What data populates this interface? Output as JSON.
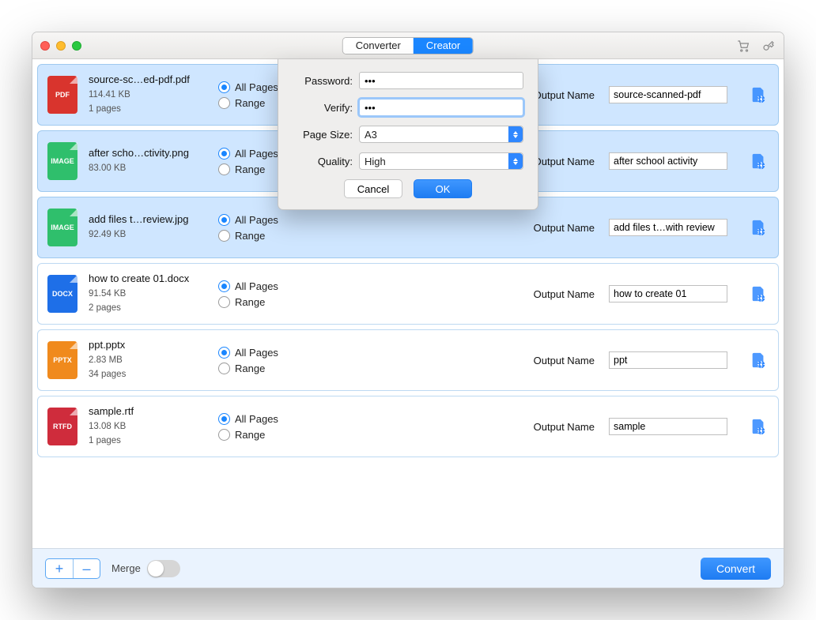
{
  "tabs": {
    "converter": "Converter",
    "creator": "Creator"
  },
  "labels": {
    "all_pages": "All Pages",
    "range": "Range",
    "output_name": "Output Name",
    "merge": "Merge",
    "convert": "Convert",
    "add": "+",
    "remove": "–"
  },
  "dialog": {
    "password_label": "Password:",
    "password_value": "•••",
    "verify_label": "Verify:",
    "verify_value": "•••",
    "pagesize_label": "Page Size:",
    "pagesize_value": "A3",
    "quality_label": "Quality:",
    "quality_value": "High",
    "cancel": "Cancel",
    "ok": "OK"
  },
  "files": [
    {
      "type": "PDF",
      "cls": "fi-pdf",
      "name": "source-sc…ed-pdf.pdf",
      "size": "114.41 KB",
      "pages": "1 pages",
      "output": "source-scanned-pdf",
      "selected": true
    },
    {
      "type": "IMAGE",
      "cls": "fi-image",
      "name": "after scho…ctivity.png",
      "size": "83.00 KB",
      "pages": "",
      "output": "after school activity",
      "selected": true
    },
    {
      "type": "IMAGE",
      "cls": "fi-image",
      "name": "add files t…review.jpg",
      "size": "92.49 KB",
      "pages": "",
      "output": "add files t…with review",
      "selected": true
    },
    {
      "type": "DOCX",
      "cls": "fi-docx",
      "name": "how to create 01.docx",
      "size": "91.54 KB",
      "pages": "2 pages",
      "output": "how to create 01",
      "selected": false
    },
    {
      "type": "PPTX",
      "cls": "fi-pptx",
      "name": "ppt.pptx",
      "size": "2.83 MB",
      "pages": "34 pages",
      "output": "ppt",
      "selected": false
    },
    {
      "type": "RTFD",
      "cls": "fi-rtfd",
      "name": "sample.rtf",
      "size": "13.08 KB",
      "pages": "1 pages",
      "output": "sample",
      "selected": false
    }
  ]
}
